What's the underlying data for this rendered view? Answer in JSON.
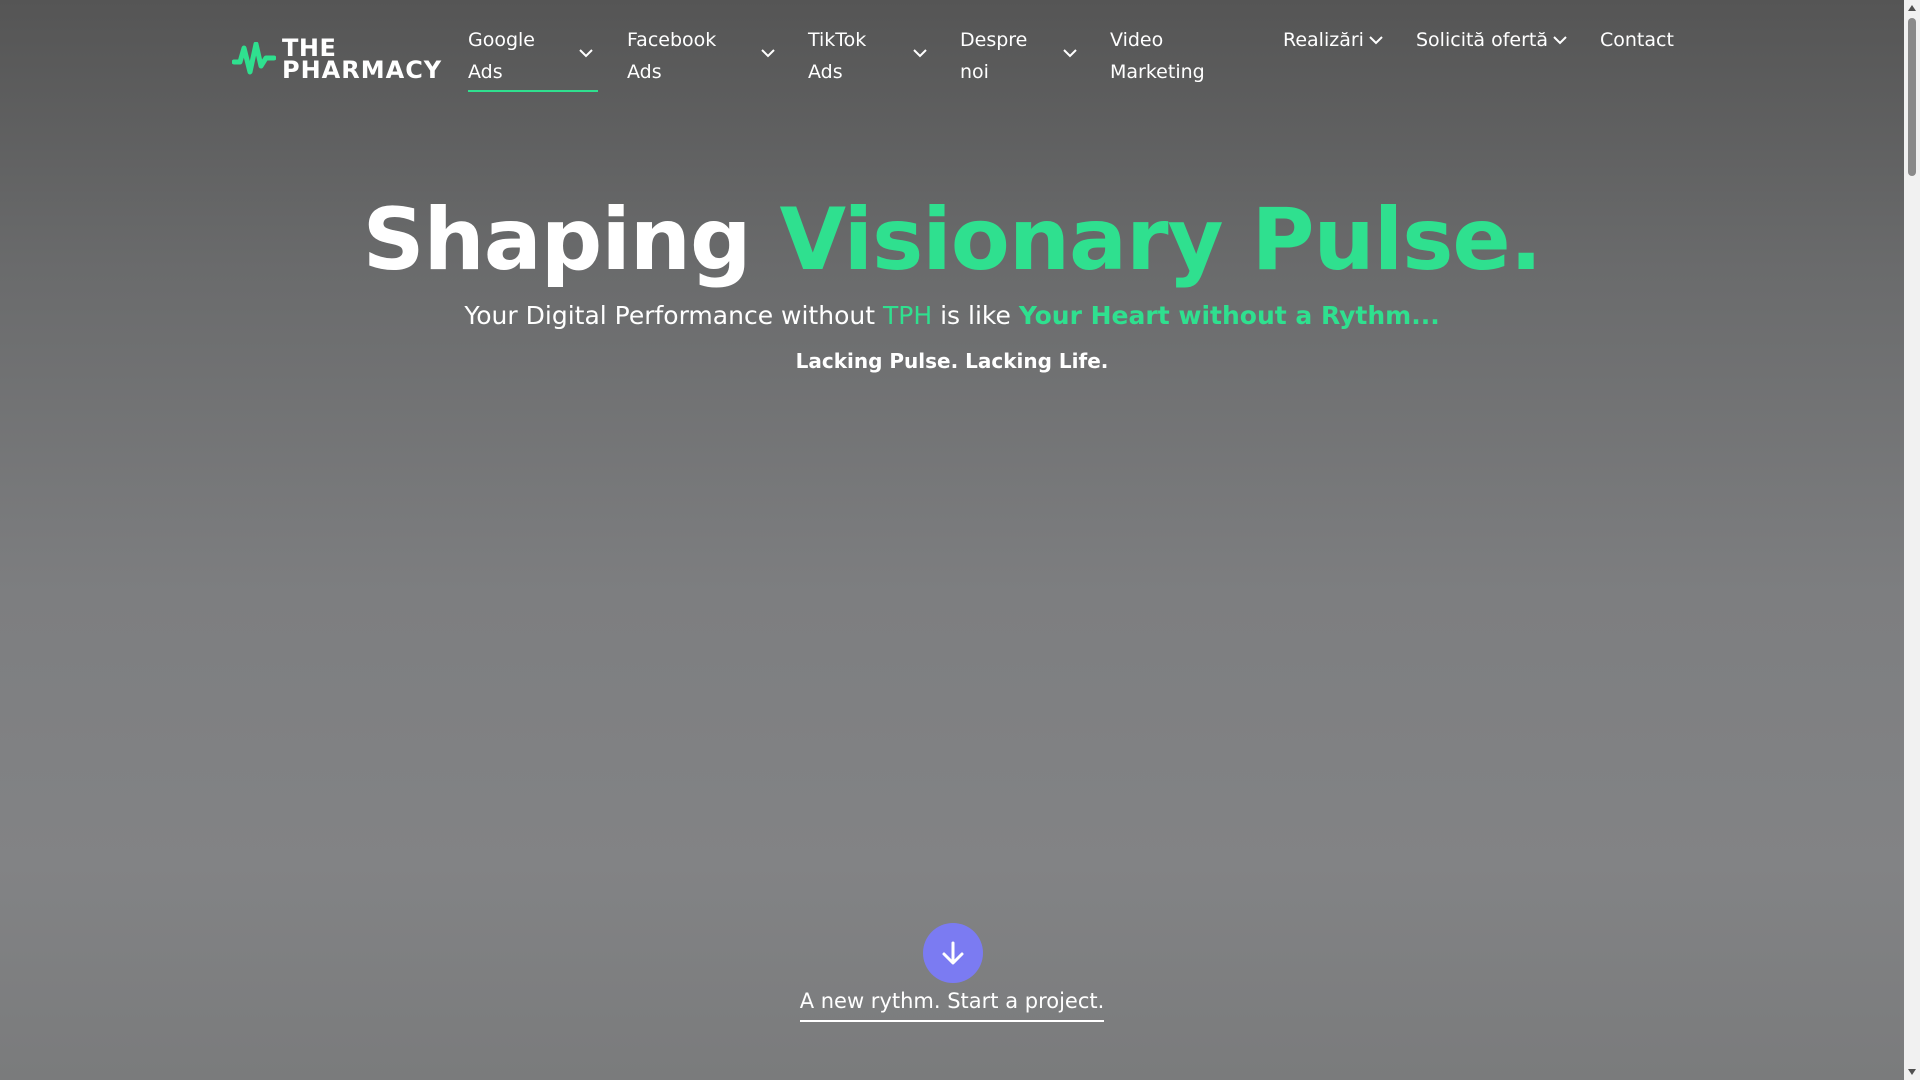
{
  "brand": {
    "line1": "THE",
    "line2": "PHARMACY",
    "accent_color": "#2fe08f"
  },
  "nav": {
    "items": [
      {
        "line1": "Google",
        "line2": "Ads",
        "has_dropdown": true,
        "active": true
      },
      {
        "line1": "Facebook",
        "line2": "Ads",
        "has_dropdown": true
      },
      {
        "line1": "TikTok",
        "line2": "Ads",
        "has_dropdown": true
      },
      {
        "line1": "Despre",
        "line2": "noi",
        "has_dropdown": true
      },
      {
        "line1": "Video",
        "line2": "Marketing",
        "has_dropdown": false
      },
      {
        "line1": "Realizări",
        "line2": "",
        "has_dropdown": true
      },
      {
        "line1": "Solicită ofertă",
        "line2": "",
        "has_dropdown": true
      },
      {
        "line1": "Contact",
        "line2": "",
        "has_dropdown": false
      }
    ]
  },
  "hero": {
    "title_white": "Shaping",
    "title_green": "Visionary Pulse.",
    "subtitle_part1": "Your Digital Performance without",
    "subtitle_tph": "TPH",
    "subtitle_part2": "is like",
    "subtitle_part3": "Your Heart without a Rythm...",
    "tagline": "Lacking Pulse. Lacking Life."
  },
  "cta": {
    "label": "A new rythm. Start a project.",
    "icon": "arrow-down-icon",
    "color": "#7b7bf2"
  }
}
